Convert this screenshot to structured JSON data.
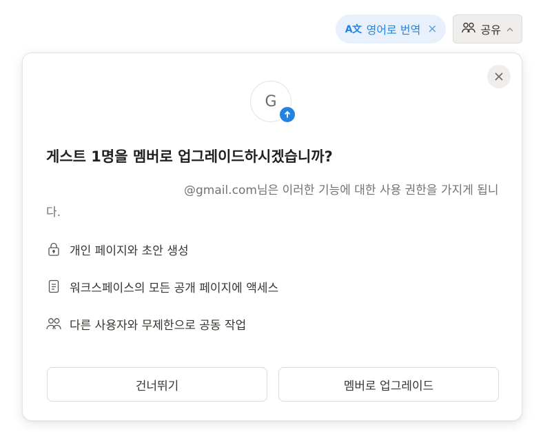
{
  "topbar": {
    "translate_icon_text": "A文",
    "translate_label": "영어로 번역",
    "translate_close": "×",
    "share_label": "공유",
    "share_chevron": "^"
  },
  "modal": {
    "avatar_letter": "G",
    "title": "게스트 1명을 멤버로 업그레이드하시겠습니까?",
    "description_email": "@gmail.com",
    "description_rest": "님은 이러한 기능에 대한 사용 권한을 가지게 됩니다.",
    "features": [
      {
        "icon": "lock-icon",
        "label": "개인 페이지와 초안 생성"
      },
      {
        "icon": "document-icon",
        "label": "워크스페이스의 모든 공개 페이지에 액세스"
      },
      {
        "icon": "people-icon",
        "label": "다른 사용자와 무제한으로 공동 작업"
      }
    ],
    "skip_label": "건너뛰기",
    "upgrade_label": "멤버로 업그레이드"
  },
  "colors": {
    "accent": "#2383e2",
    "translate_bg": "#e8f1fb",
    "text": "#37352f",
    "muted": "#73726e"
  }
}
